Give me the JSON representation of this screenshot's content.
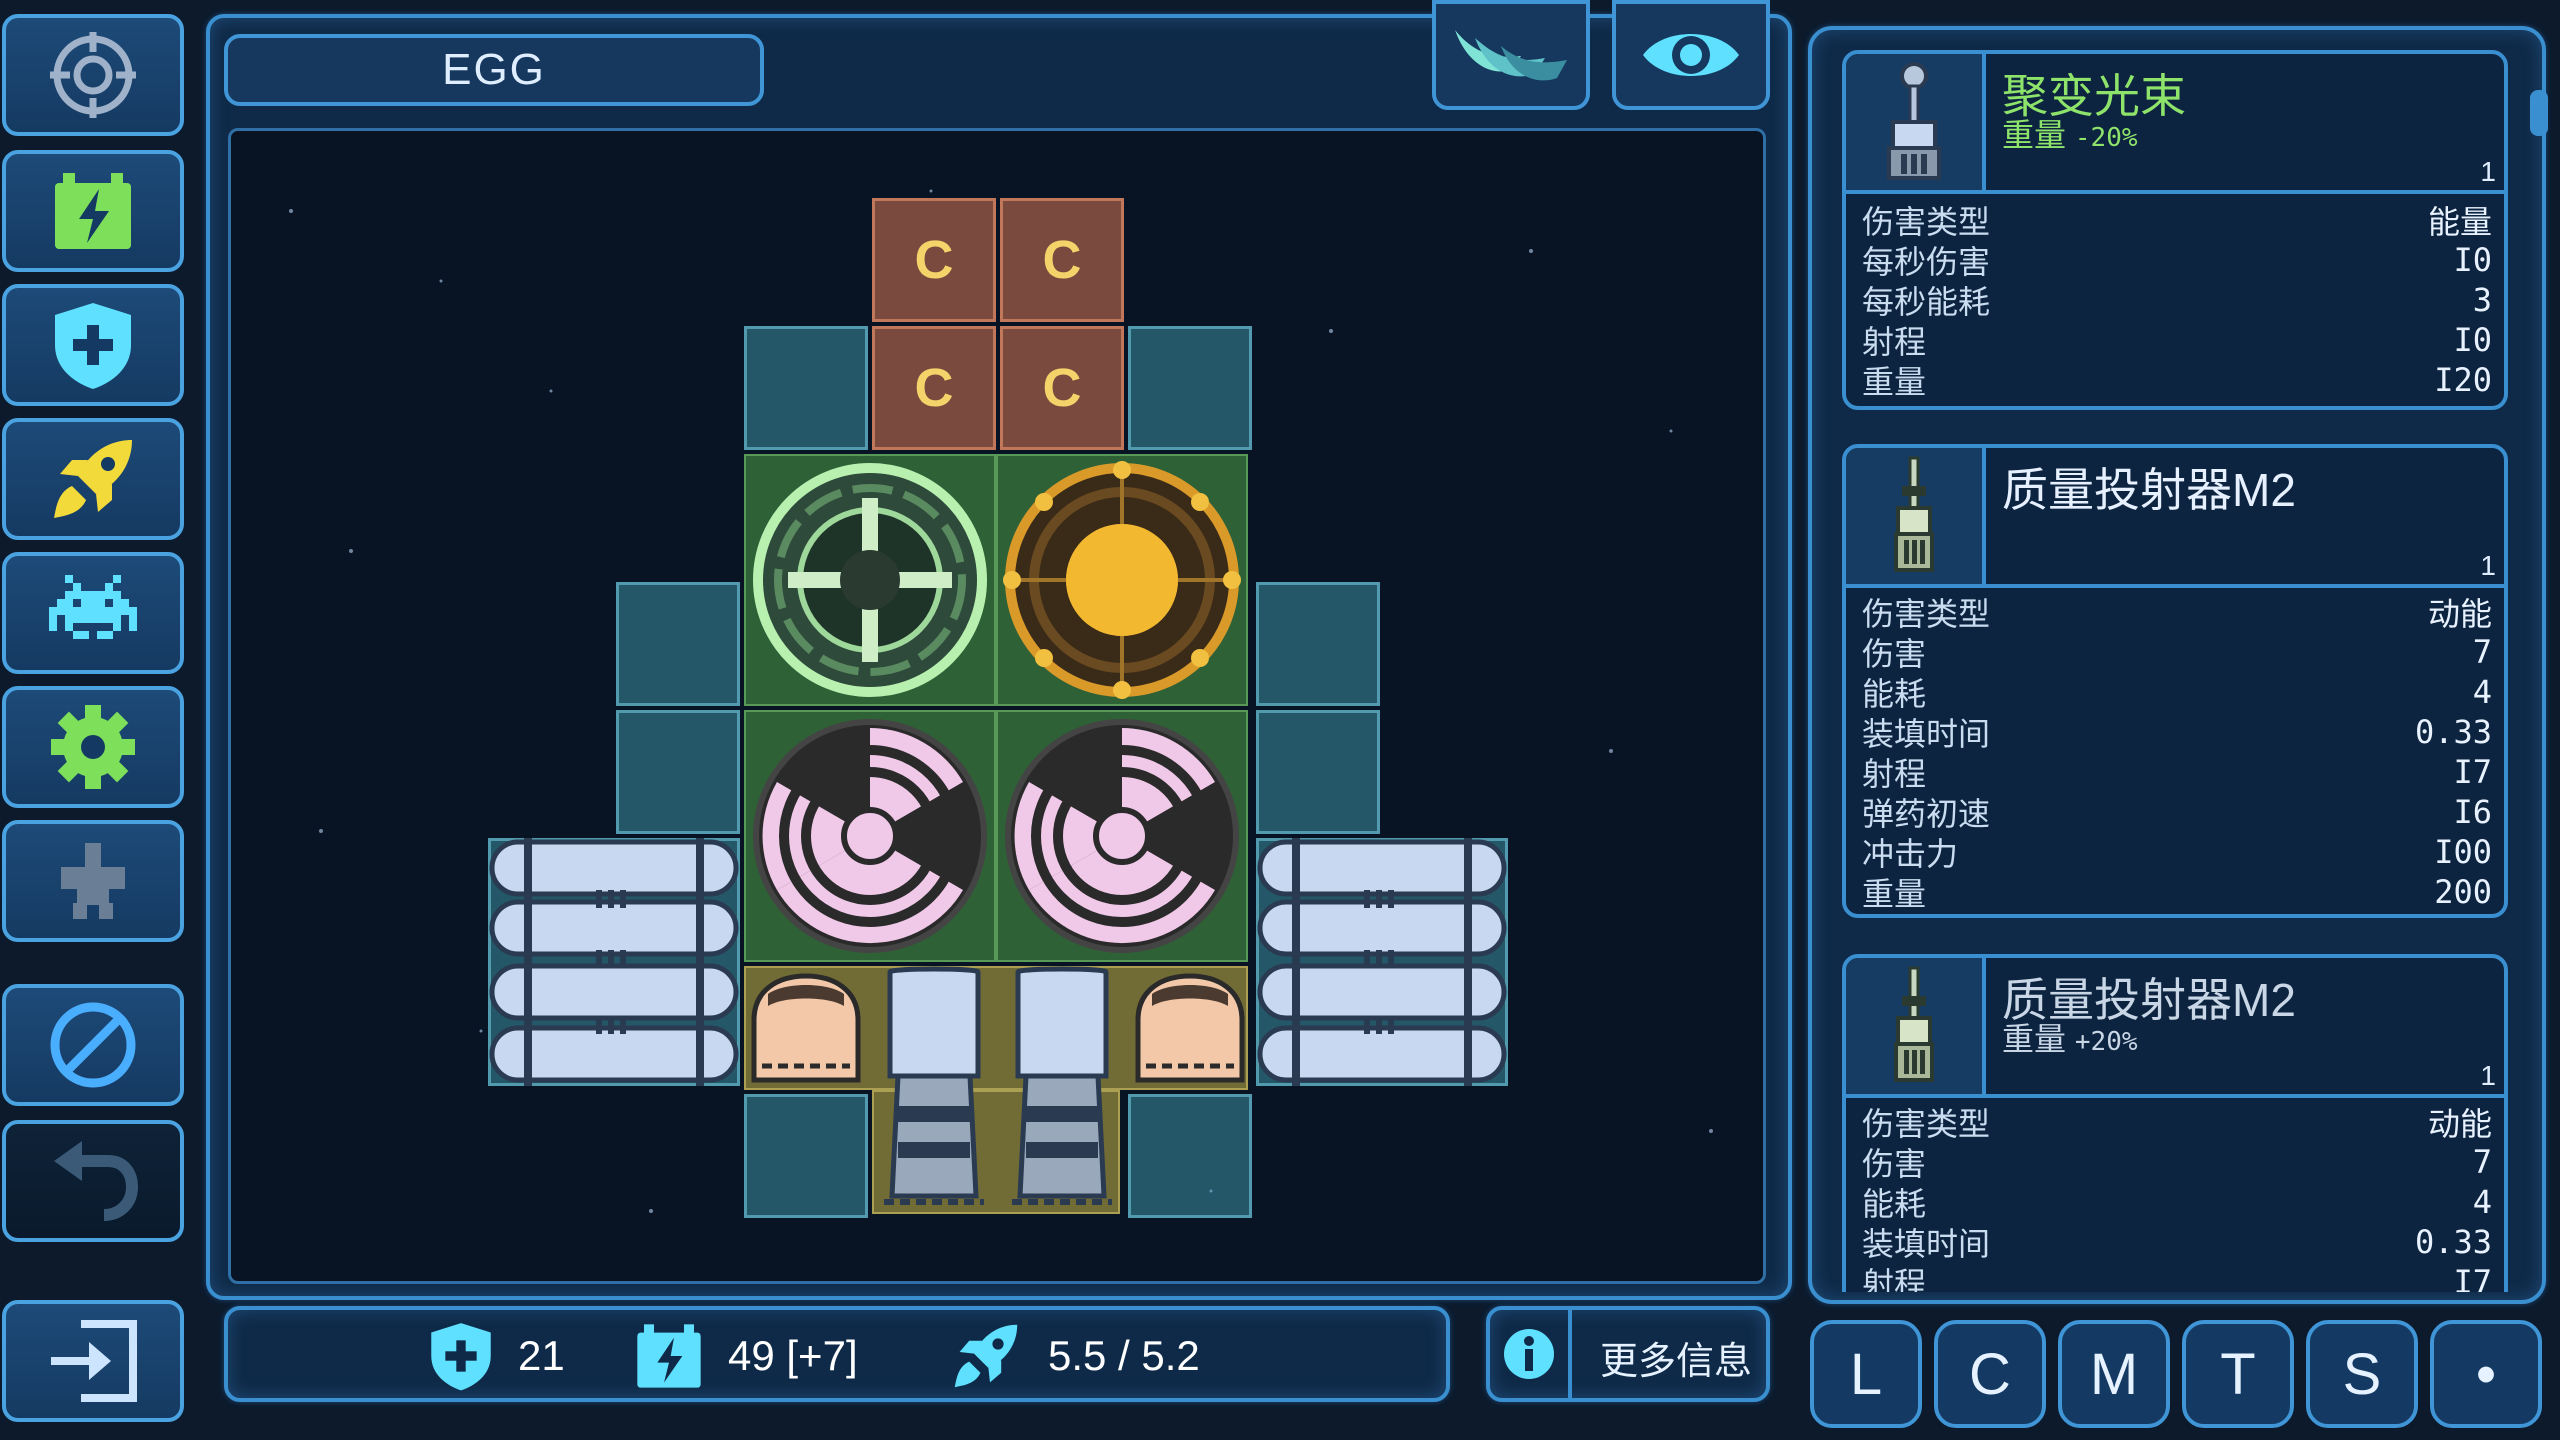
{
  "title": "EGG",
  "sidebar": {
    "items": [
      {
        "icon": "target-icon"
      },
      {
        "icon": "battery-icon"
      },
      {
        "icon": "shield-plus-icon"
      },
      {
        "icon": "rocket-icon"
      },
      {
        "icon": "invader-icon"
      },
      {
        "icon": "gear-icon"
      },
      {
        "icon": "ship-icon"
      },
      {
        "icon": "no-entry-icon"
      },
      {
        "icon": "undo-icon"
      },
      {
        "icon": "exit-icon"
      }
    ]
  },
  "top_buttons": [
    {
      "icon": "wings-icon"
    },
    {
      "icon": "eye-icon"
    }
  ],
  "grid": {
    "c_label": "C"
  },
  "status": {
    "shield": "21",
    "energy": "49 [+7]",
    "speed": "5.5 / 5.2",
    "more_info": "更多信息"
  },
  "cards": [
    {
      "name": "聚变光束",
      "name_color": "#8ee36a",
      "sub_label": "重量",
      "sub_value": "-20%",
      "sub_color": "#8ee36a",
      "count": "1",
      "stats": [
        {
          "label": "伤害类型",
          "value": "能量"
        },
        {
          "label": "每秒伤害",
          "value": "I0"
        },
        {
          "label": "每秒能耗",
          "value": "3"
        },
        {
          "label": "射程",
          "value": "I0"
        },
        {
          "label": "重量",
          "value": "I20"
        }
      ]
    },
    {
      "name": "质量投射器M2",
      "name_color": "#e6f0ff",
      "sub_label": "",
      "sub_value": "",
      "sub_color": "#e6f0ff",
      "count": "1",
      "stats": [
        {
          "label": "伤害类型",
          "value": "动能"
        },
        {
          "label": "伤害",
          "value": "7"
        },
        {
          "label": "能耗",
          "value": "4"
        },
        {
          "label": "装填时间",
          "value": "0.33"
        },
        {
          "label": "射程",
          "value": "I7"
        },
        {
          "label": "弹药初速",
          "value": "I6"
        },
        {
          "label": "冲击力",
          "value": "I00"
        },
        {
          "label": "重量",
          "value": "200"
        }
      ]
    },
    {
      "name": "质量投射器M2",
      "name_color": "#c8d6e6",
      "sub_label": "重量",
      "sub_value": "+20%",
      "sub_color": "#c8d6e6",
      "count": "1",
      "stats": [
        {
          "label": "伤害类型",
          "value": "动能"
        },
        {
          "label": "伤害",
          "value": "7"
        },
        {
          "label": "能耗",
          "value": "4"
        },
        {
          "label": "装填时间",
          "value": "0.33"
        },
        {
          "label": "射程",
          "value": "I7"
        }
      ]
    }
  ],
  "filter_tabs": [
    "L",
    "C",
    "M",
    "T",
    "S",
    "•"
  ],
  "colors": {
    "accent": "#3a8fd0",
    "panel": "#0f2a48",
    "background": "#0c1a2c",
    "icon_cyan": "#5fe0ff",
    "icon_green": "#7ee05a",
    "icon_yellow": "#f2da3a",
    "icon_red": "#e04030"
  }
}
